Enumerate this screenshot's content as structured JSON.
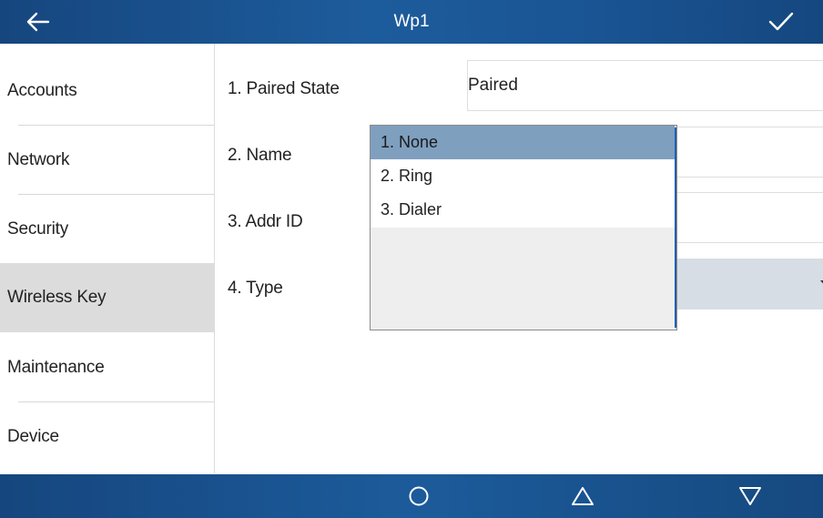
{
  "header": {
    "title": "Wp1",
    "back_icon": "arrow-left-icon",
    "confirm_icon": "check-icon"
  },
  "sidebar": {
    "items": [
      {
        "label": "Accounts"
      },
      {
        "label": "Network"
      },
      {
        "label": "Security"
      },
      {
        "label": "Wireless Key",
        "active": true
      },
      {
        "label": "Maintenance"
      },
      {
        "label": "Device"
      }
    ]
  },
  "settings": {
    "rows": [
      {
        "label": "1. Paired State",
        "value": "Paired"
      },
      {
        "label": "2. Name",
        "value": ""
      },
      {
        "label": "3. Addr ID",
        "value": ""
      },
      {
        "label": "4. Type",
        "value": ""
      }
    ]
  },
  "dropdown": {
    "options": [
      "1. None",
      "2. Ring",
      "3. Dialer"
    ],
    "selected_index": 0
  },
  "bottombar": {
    "icons": [
      "circle-icon",
      "triangle-up-icon",
      "triangle-down-icon"
    ]
  },
  "colors": {
    "header_bg": "#1a5393",
    "active_item_bg": "#dcdcdc",
    "selected_option_bg": "#7f9fbf",
    "select_field_bg": "#d7dde4"
  }
}
